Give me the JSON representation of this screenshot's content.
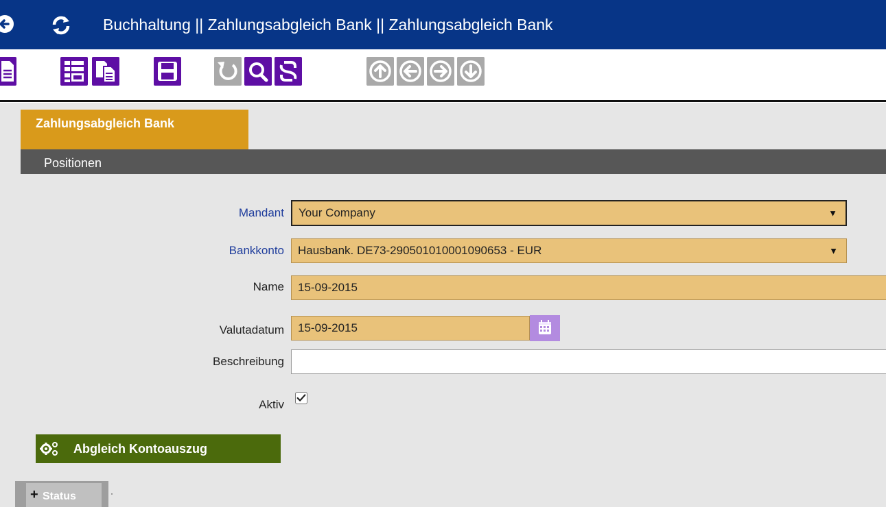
{
  "header": {
    "title": "Buchhaltung || Zahlungsabgleich Bank  ||  Zahlungsabgleich Bank",
    "back_icon": "circle-arrow-left-icon",
    "refresh_icon": "refresh-icon"
  },
  "toolbar": {
    "buttons": [
      {
        "name": "new-document-icon",
        "style": "purple"
      },
      {
        "name": "grid-view-icon",
        "style": "purple"
      },
      {
        "name": "copy-document-icon",
        "style": "purple"
      },
      {
        "name": "save-icon",
        "style": "purple"
      },
      {
        "name": "undo-icon",
        "style": "gray"
      },
      {
        "name": "search-icon",
        "style": "purple"
      },
      {
        "name": "link-icon",
        "style": "purple"
      },
      {
        "name": "arrow-up-icon",
        "style": "gray"
      },
      {
        "name": "arrow-left-icon",
        "style": "gray"
      },
      {
        "name": "arrow-right-icon",
        "style": "gray"
      },
      {
        "name": "arrow-down-icon",
        "style": "gray"
      }
    ]
  },
  "tabs": {
    "active_label": "Zahlungsabgleich Bank",
    "subtab_label": "Positionen"
  },
  "form": {
    "mandant_label": "Mandant",
    "mandant_value": "Your Company",
    "bankkonto_label": "Bankkonto",
    "bankkonto_value": "Hausbank. DE73-290501010001090653 - EUR",
    "name_label": "Name",
    "name_value": "15-09-2015",
    "valutadatum_label": "Valutadatum",
    "valutadatum_value": "15-09-2015",
    "beschreibung_label": "Beschreibung",
    "beschreibung_value": "",
    "aktiv_label": "Aktiv",
    "aktiv_checked": true
  },
  "actions": {
    "abgleich_label": "Abgleich Kontoauszug"
  },
  "status_tab": {
    "plus": "+",
    "label": "Status"
  },
  "colors": {
    "header_bg": "#073587",
    "toolbar_purple": "#5e0ea4",
    "toolbar_gray": "#a9a9a9",
    "tab_active": "#d99a1b",
    "tab_bar": "#575757",
    "field_bg": "#e9c27a",
    "action_green": "#4b6a0c"
  }
}
